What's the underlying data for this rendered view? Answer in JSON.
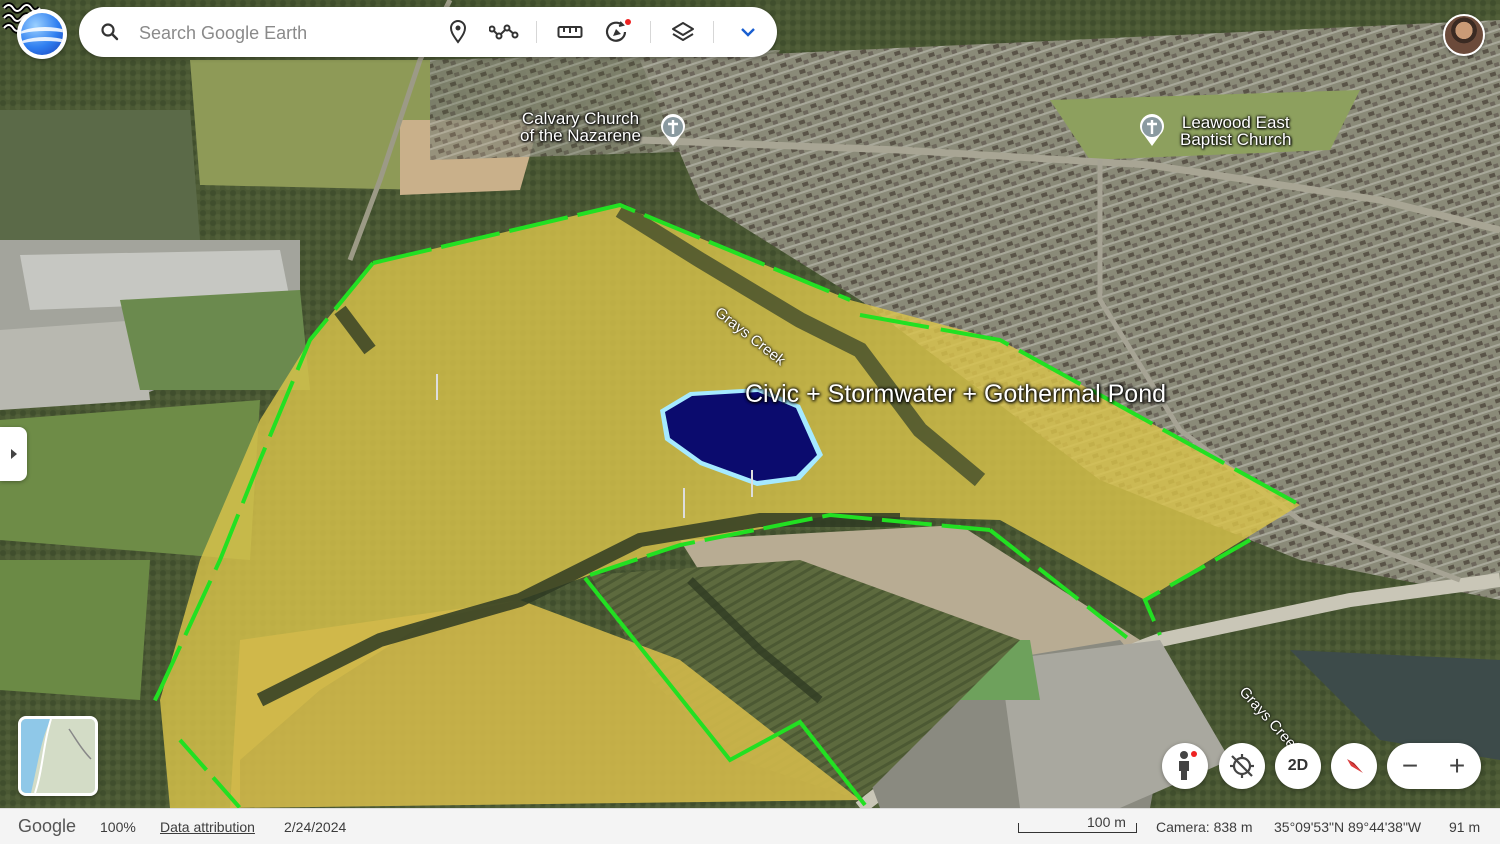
{
  "search": {
    "placeholder": "Search Google Earth"
  },
  "toolbar": {
    "icons": [
      "place-pin-icon",
      "path-icon",
      "ruler-icon",
      "voyager-icon",
      "layers-icon",
      "chevron-down-icon"
    ]
  },
  "map": {
    "places": [
      {
        "line1": "Calvary Church",
        "line2": "of the Nazarene"
      },
      {
        "line1": "Leawood East",
        "line2": "Baptist Church"
      }
    ],
    "roads": [
      "Grays Creek",
      "Grays Creek"
    ],
    "feature_label": "Civic + Stormwater + Gothermal Pond",
    "colors": {
      "boundary": "#22e022",
      "pond_fill": "#0b0b6e",
      "pond_outline": "#a6eaff",
      "field_overlay": "#d9c34a"
    }
  },
  "controls": {
    "two_d": "2D",
    "zoom_out": "−",
    "zoom_in": "+"
  },
  "status": {
    "logo": "Google",
    "zoom": "100%",
    "data_attribution": "Data attribution",
    "imagery_date": "2/24/2024",
    "scale": "100 m",
    "camera": "Camera: 838 m",
    "coordinates": "35°09'53\"N 89°44'38\"W",
    "elevation": "91 m"
  }
}
